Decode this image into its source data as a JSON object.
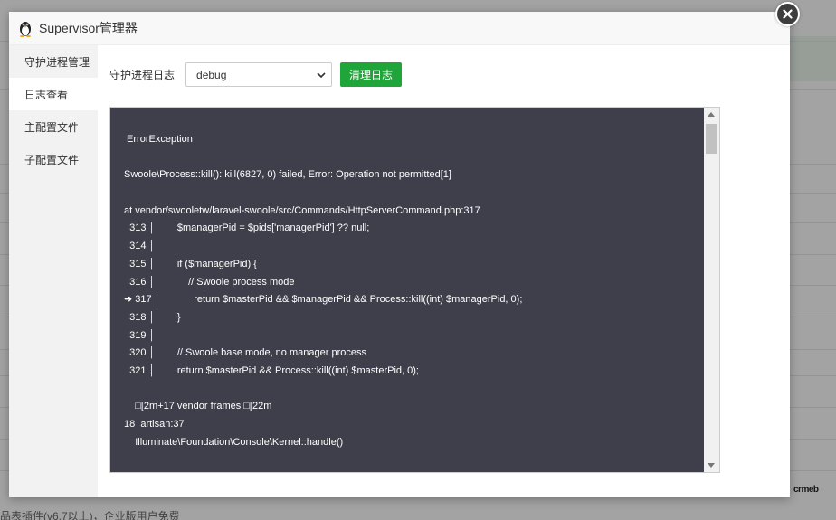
{
  "dialog": {
    "title": "Supervisor管理器",
    "close_icon": "close-icon"
  },
  "sidebar": {
    "items": [
      {
        "label": "守护进程管理"
      },
      {
        "label": "日志查看",
        "active": true
      },
      {
        "label": "主配置文件"
      },
      {
        "label": "子配置文件"
      }
    ]
  },
  "toolbar": {
    "label": "守护进程日志",
    "select_value": "debug",
    "clear_label": "清理日志"
  },
  "log": {
    "lines": [
      " ErrorException",
      "",
      "Swoole\\Process::kill(): kill(6827, 0) failed, Error: Operation not permitted[1]",
      "",
      "at vendor/swooletw/laravel-swoole/src/Commands/HttpServerCommand.php:317",
      "  313 │        $managerPid = $pids['managerPid'] ?? null;",
      "  314 │",
      "  315 │        if ($managerPid) {",
      "  316 │            // Swoole process mode",
      "➜ 317 │            return $masterPid && $managerPid && Process::kill((int) $managerPid, 0);",
      "  318 │        }",
      "  319 │",
      "  320 │        // Swoole base mode, no manager process",
      "  321 │        return $masterPid && Process::kill((int) $masterPid, 0);",
      "",
      "    \u001b[2m+17 vendor frames \u001b[22m",
      "18  artisan:37",
      "    Illuminate\\Foundation\\Console\\Kernel::handle()"
    ]
  },
  "background": {
    "bottom_text": "品表插件(v6.7以上)，企业版用户免费",
    "brand": "crmeb"
  },
  "colors": {
    "accent": "#20a53a",
    "log_bg": "#3f3f4b"
  }
}
